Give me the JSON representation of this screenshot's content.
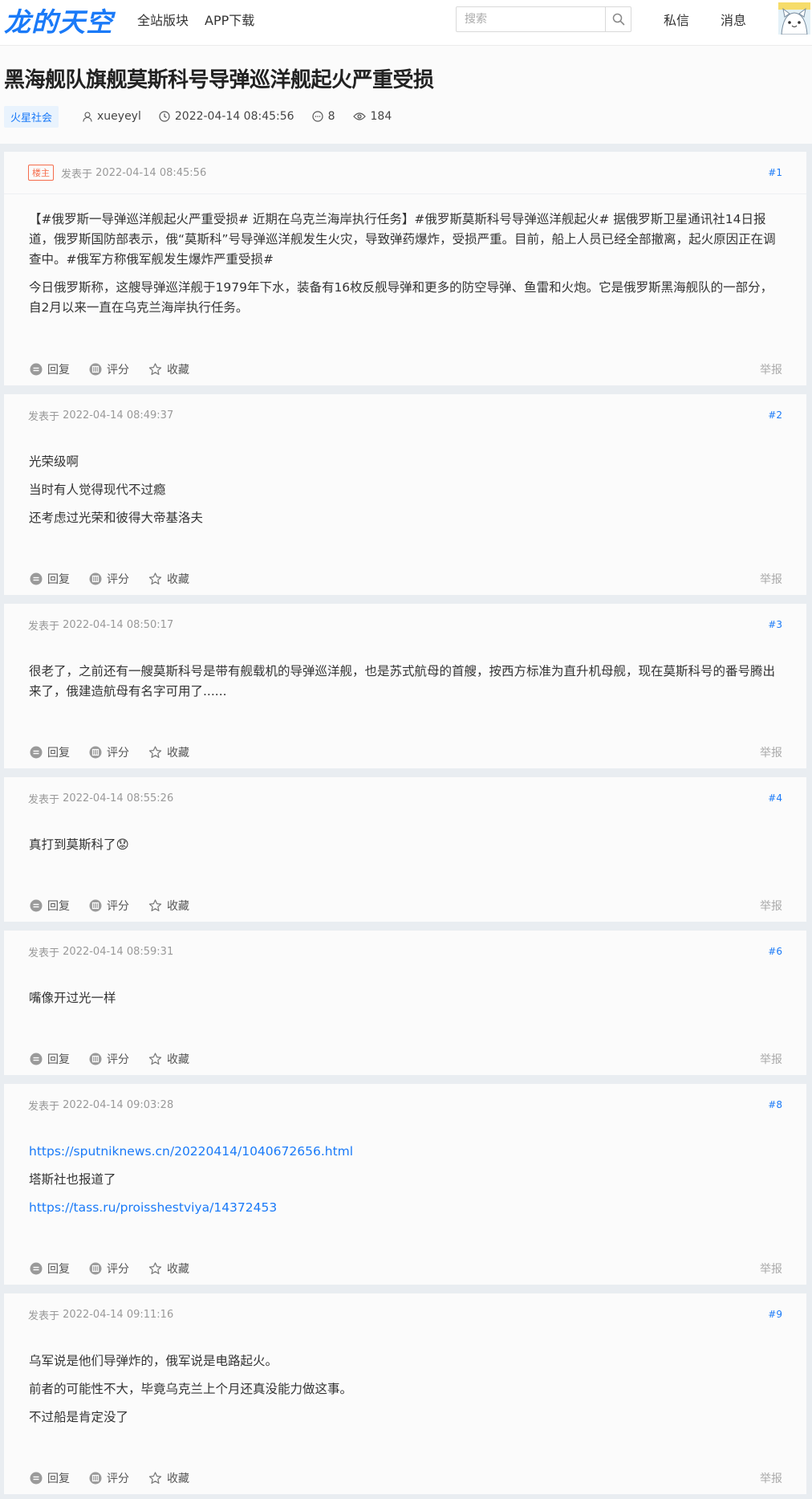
{
  "header": {
    "logo_text": "龙的天空",
    "nav": [
      "全站版块",
      "APP下载"
    ],
    "search_placeholder": "搜索",
    "messages_label": "私信",
    "notifications_label": "消息"
  },
  "thread": {
    "title": "黑海舰队旗舰莫斯科号导弹巡洋舰起火严重受损",
    "category": "火星社会",
    "author": "xueyeyl",
    "time": "2022-04-14 08:45:56",
    "comments": "8",
    "views": "184"
  },
  "labels": {
    "posted_prefix": "发表于",
    "op_badge": "楼主",
    "reply": "回复",
    "rate": "评分",
    "favorite": "收藏",
    "report": "举报"
  },
  "posts": [
    {
      "floor": "#1",
      "time": "2022-04-14 08:45:56",
      "is_op": true,
      "paragraphs": [
        "【#俄罗斯一导弹巡洋舰起火严重受损# 近期在乌克兰海岸执行任务】#俄罗斯莫斯科号导弹巡洋舰起火# 据俄罗斯卫星通讯社14日报道，俄罗斯国防部表示，俄“莫斯科”号导弹巡洋舰发生火灾，导致弹药爆炸，受损严重。目前，船上人员已经全部撤离，起火原因正在调查中。#俄军方称俄军舰发生爆炸严重受损#",
        "今日俄罗斯称，这艘导弹巡洋舰于1979年下水，装备有16枚反舰导弹和更多的防空导弹、鱼雷和火炮。它是俄罗斯黑海舰队的一部分，自2月以来一直在乌克兰海岸执行任务。"
      ]
    },
    {
      "floor": "#2",
      "time": "2022-04-14 08:49:37",
      "paragraphs": [
        "光荣级啊",
        "当时有人觉得现代不过瘾",
        "还考虑过光荣和彼得大帝基洛夫"
      ]
    },
    {
      "floor": "#3",
      "time": "2022-04-14 08:50:17",
      "paragraphs": [
        "很老了，之前还有一艘莫斯科号是带有舰载机的导弹巡洋舰，也是苏式航母的首艘，按西方标准为直升机母舰，现在莫斯科号的番号腾出来了，俄建造航母有名字可用了......"
      ]
    },
    {
      "floor": "#4",
      "time": "2022-04-14 08:55:26",
      "paragraphs": [
        "真打到莫斯科了😟"
      ]
    },
    {
      "floor": "#6",
      "time": "2022-04-14 08:59:31",
      "paragraphs": [
        "嘴像开过光一样"
      ]
    },
    {
      "floor": "#8",
      "time": "2022-04-14 09:03:28",
      "paragraphs": [
        "https://sputniknews.cn/20220414/1040672656.html",
        "塔斯社也报道了",
        "https://tass.ru/proisshestviya/14372453"
      ],
      "link_indices": [
        0,
        2
      ]
    },
    {
      "floor": "#9",
      "time": "2022-04-14 09:11:16",
      "paragraphs": [
        "乌军说是他们导弹炸的，俄军说是电路起火。",
        "前者的可能性不大，毕竟乌克兰上个月还真没能力做这事。",
        "不过船是肯定没了"
      ]
    }
  ]
}
